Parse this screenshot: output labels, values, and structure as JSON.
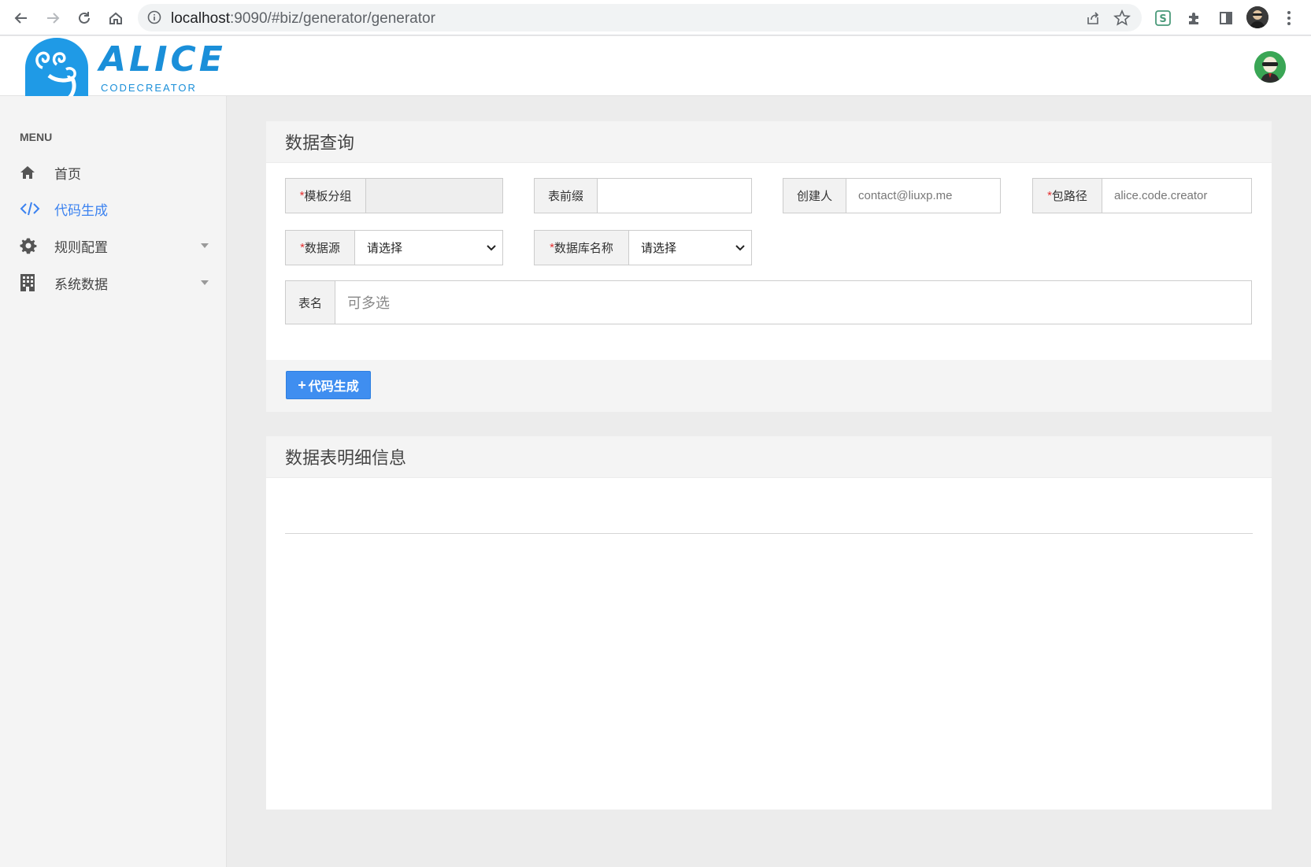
{
  "browser": {
    "url_host": "localhost",
    "url_rest": ":9090/#biz/generator/generator"
  },
  "header": {
    "logo_title": "ALICE",
    "logo_subtitle": "CODECREATOR"
  },
  "sidebar": {
    "heading": "MENU",
    "items": [
      {
        "label": "首页",
        "icon": "home-icon"
      },
      {
        "label": "代码生成",
        "icon": "code-icon",
        "active": true
      },
      {
        "label": "规则配置",
        "icon": "gear-icon"
      },
      {
        "label": "系统数据",
        "icon": "building-icon"
      }
    ]
  },
  "query_panel": {
    "title": "数据查询",
    "template_group": {
      "required_mark": "*",
      "label": "模板分组",
      "value": ""
    },
    "table_prefix": {
      "label": "表前缀",
      "value": ""
    },
    "creator": {
      "label": "创建人",
      "placeholder": "contact@liuxp.me"
    },
    "package_path": {
      "required_mark": "*",
      "label": "包路径",
      "placeholder": "alice.code.creator"
    },
    "datasource": {
      "required_mark": "*",
      "label": "数据源",
      "selected": "请选择"
    },
    "database_name": {
      "required_mark": "*",
      "label": "数据库名称",
      "selected": "请选择"
    },
    "table_name": {
      "label": "表名",
      "placeholder": "可多选"
    },
    "generate_button": "代码生成",
    "generate_button_icon": "+"
  },
  "detail_panel": {
    "title": "数据表明细信息"
  },
  "colors": {
    "accent": "#3b82f0",
    "button": "#3f8ef0",
    "required": "#e53030",
    "logo": "#1a8fd9"
  }
}
